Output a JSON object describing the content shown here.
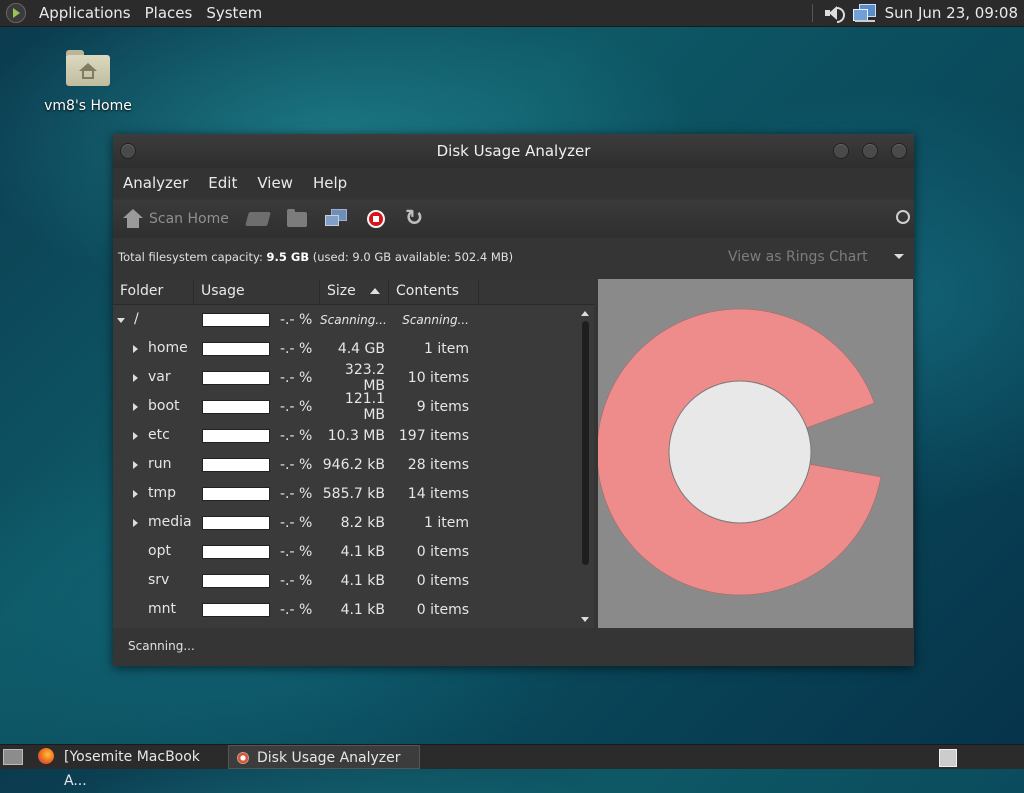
{
  "top_panel": {
    "menus": [
      "Applications",
      "Places",
      "System"
    ],
    "clock": "Sun Jun 23, 09:08"
  },
  "desktop": {
    "home_label": "vm8's Home"
  },
  "window": {
    "title": "Disk Usage Analyzer",
    "menus": [
      "Analyzer",
      "Edit",
      "View",
      "Help"
    ],
    "toolbar": {
      "scan_home": "Scan Home"
    },
    "capacity": {
      "prefix": "Total filesystem capacity: ",
      "total": "9.5 GB",
      "detail": " (used: 9.0 GB available: 502.4 MB)"
    },
    "view_select": "View as Rings Chart",
    "columns": [
      "Folder",
      "Usage",
      "Size",
      "Contents"
    ],
    "rows": [
      {
        "name": "/",
        "pct": "-.- %",
        "size": "Scanning...",
        "contents": "Scanning..."
      },
      {
        "name": "home",
        "pct": "-.- %",
        "size": "4.4 GB",
        "contents": "1 item"
      },
      {
        "name": "var",
        "pct": "-.- %",
        "size": "323.2 MB",
        "contents": "10 items"
      },
      {
        "name": "boot",
        "pct": "-.- %",
        "size": "121.1 MB",
        "contents": "9 items"
      },
      {
        "name": "etc",
        "pct": "-.- %",
        "size": "10.3 MB",
        "contents": "197 items"
      },
      {
        "name": "run",
        "pct": "-.- %",
        "size": "946.2 kB",
        "contents": "28 items"
      },
      {
        "name": "tmp",
        "pct": "-.- %",
        "size": "585.7 kB",
        "contents": "14 items"
      },
      {
        "name": "media",
        "pct": "-.- %",
        "size": "8.2 kB",
        "contents": "1 item"
      },
      {
        "name": "opt",
        "pct": "-.- %",
        "size": "4.1 kB",
        "contents": "0 items"
      },
      {
        "name": "srv",
        "pct": "-.- %",
        "size": "4.1 kB",
        "contents": "0 items"
      },
      {
        "name": "mnt",
        "pct": "-.- %",
        "size": "4.1 kB",
        "contents": "0 items"
      }
    ],
    "status": "Scanning...",
    "ring_colors": {
      "ring": "#ee8b8b",
      "center": "#e8e8e8",
      "background": "#8a8a8a"
    }
  },
  "taskbar": {
    "tasks": [
      "[Yosemite MacBook A...",
      "Disk Usage Analyzer"
    ]
  }
}
